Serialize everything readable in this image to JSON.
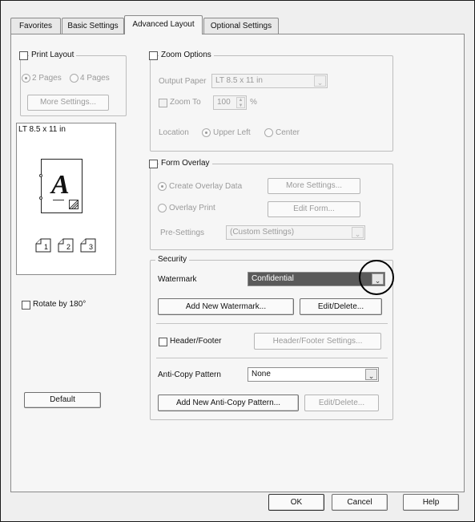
{
  "tabs": [
    {
      "label": "Favorites"
    },
    {
      "label": "Basic Settings"
    },
    {
      "label": "Advanced Layout"
    },
    {
      "label": "Optional Settings"
    }
  ],
  "print_layout": {
    "label": "Print Layout",
    "option_2pages": "2 Pages",
    "option_4pages": "4 Pages",
    "more_settings": "More Settings..."
  },
  "preview": {
    "paper_label": "LT 8.5 x 11 in",
    "sample_letter": "A"
  },
  "rotate": {
    "label": "Rotate by 180°"
  },
  "default_button": "Default",
  "zoom": {
    "label": "Zoom Options",
    "output_paper_label": "Output Paper",
    "output_paper_value": "LT 8.5 x 11 in",
    "zoom_to_label": "Zoom To",
    "zoom_value": "100",
    "percent": "%",
    "location_label": "Location",
    "upper_left": "Upper Left",
    "center": "Center"
  },
  "form_overlay": {
    "label": "Form Overlay",
    "create_overlay": "Create Overlay Data",
    "more_settings": "More Settings...",
    "overlay_print": "Overlay Print",
    "edit_form": "Edit Form...",
    "presettings_label": "Pre-Settings",
    "presettings_value": "(Custom Settings)"
  },
  "security": {
    "label": "Security",
    "watermark_label": "Watermark",
    "watermark_value": "Confidential",
    "add_watermark": "Add New Watermark...",
    "edit_delete": "Edit/Delete...",
    "header_footer": "Header/Footer",
    "header_footer_settings": "Header/Footer Settings...",
    "anticopy_label": "Anti-Copy Pattern",
    "anticopy_value": "None",
    "add_anticopy": "Add New Anti-Copy Pattern...",
    "anticopy_edit_delete": "Edit/Delete..."
  },
  "footer": {
    "ok": "OK",
    "cancel": "Cancel",
    "help": "Help"
  },
  "colors": {
    "selection": "#5a5a5a",
    "highlight_circle": "#000000"
  }
}
